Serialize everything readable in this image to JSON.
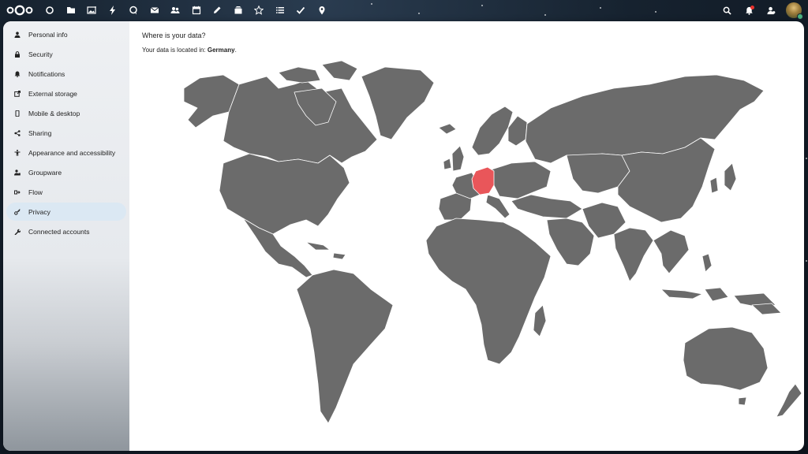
{
  "header": {
    "logo": "nextcloud-logo",
    "apps": [
      {
        "name": "dashboard",
        "icon": "circle-icon"
      },
      {
        "name": "files",
        "icon": "folder-icon"
      },
      {
        "name": "photos",
        "icon": "image-icon"
      },
      {
        "name": "activity",
        "icon": "lightning-icon"
      },
      {
        "name": "talk",
        "icon": "chat-icon"
      },
      {
        "name": "mail",
        "icon": "mail-icon"
      },
      {
        "name": "contacts",
        "icon": "contacts-icon"
      },
      {
        "name": "calendar",
        "icon": "calendar-icon"
      },
      {
        "name": "notes",
        "icon": "pencil-icon"
      },
      {
        "name": "deck",
        "icon": "deck-icon"
      },
      {
        "name": "app-store",
        "icon": "star-icon"
      },
      {
        "name": "tasks",
        "icon": "list-icon"
      },
      {
        "name": "check",
        "icon": "check-icon"
      },
      {
        "name": "maps",
        "icon": "map-pin-icon"
      }
    ],
    "right": [
      {
        "name": "search",
        "icon": "search-icon"
      },
      {
        "name": "notifications",
        "icon": "bell-icon"
      },
      {
        "name": "contacts-menu",
        "icon": "user-icon"
      }
    ]
  },
  "sidebar": {
    "items": [
      {
        "label": "Personal info",
        "icon": "person-icon"
      },
      {
        "label": "Security",
        "icon": "lock-icon"
      },
      {
        "label": "Notifications",
        "icon": "bell-icon"
      },
      {
        "label": "External storage",
        "icon": "external-link-icon"
      },
      {
        "label": "Mobile & desktop",
        "icon": "phone-icon"
      },
      {
        "label": "Sharing",
        "icon": "share-icon"
      },
      {
        "label": "Appearance and accessibility",
        "icon": "accessibility-icon"
      },
      {
        "label": "Groupware",
        "icon": "groupware-icon"
      },
      {
        "label": "Flow",
        "icon": "flow-icon"
      },
      {
        "label": "Privacy",
        "icon": "key-icon",
        "active": true
      },
      {
        "label": "Connected accounts",
        "icon": "wrench-icon"
      }
    ]
  },
  "main": {
    "title": "Where is your data?",
    "location_prefix": "Your data is located in: ",
    "location_country": "Germany",
    "location_suffix": ".",
    "map_color": "#6b6b6b",
    "highlight_color": "#e9565a"
  },
  "colors": {
    "accent": "#dbe8f3",
    "header_bg": "#16222f"
  }
}
